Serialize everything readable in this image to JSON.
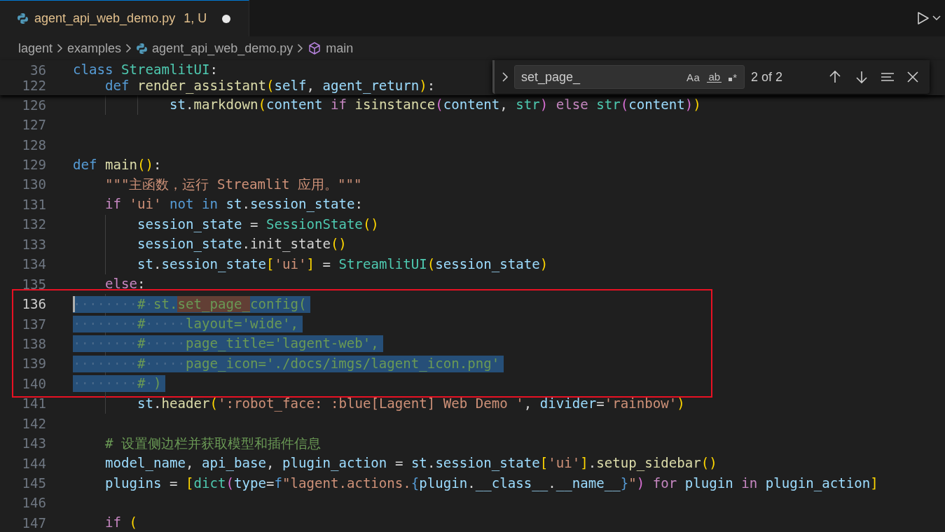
{
  "tabs": [
    {
      "title": "agent_api_web_demo.py",
      "status": "1, U",
      "dirty": true,
      "selected": true
    }
  ],
  "breadcrumbs": [
    {
      "text": "lagent",
      "kind": "folder"
    },
    {
      "text": "examples",
      "kind": "folder"
    },
    {
      "text": "agent_api_web_demo.py",
      "kind": "python-file"
    },
    {
      "text": "main",
      "kind": "symbol"
    }
  ],
  "find": {
    "query": "set_page_",
    "options": [
      {
        "label": "Aa",
        "kind": "case",
        "selected": false
      },
      {
        "label": "ab",
        "kind": "word",
        "selected": false
      },
      {
        "label": "*",
        "kind": "regex",
        "selected": false
      }
    ],
    "count": "2 of 2"
  },
  "annotation": {
    "kind": "rectangle",
    "color": "#e81123"
  },
  "sticky_lines": [
    {
      "number": "36",
      "tokens": [
        {
          "kind": "kw",
          "text": "class"
        },
        {
          "kind": "cls",
          "text": " StreamlitUI"
        },
        {
          "kind": "plain",
          "text": ":"
        }
      ]
    },
    {
      "number": "122",
      "tokens": [
        {
          "kind": "kw",
          "text": "    def"
        },
        {
          "kind": "fn",
          "text": " render_assistant"
        },
        {
          "kind": "b1",
          "text": "("
        },
        {
          "kind": "var",
          "text": "self"
        },
        {
          "kind": "plain",
          "text": ","
        },
        {
          "kind": "var",
          "text": " agent_return"
        },
        {
          "kind": "b1",
          "text": ")"
        },
        {
          "kind": "plain",
          "text": ":"
        }
      ]
    }
  ],
  "lines": [
    {
      "number": "126",
      "selected": false,
      "current": false,
      "tokens": [
        {
          "kind": "var",
          "text": "            st"
        },
        {
          "kind": "plain",
          "text": "."
        },
        {
          "kind": "fn",
          "text": "markdown"
        },
        {
          "kind": "b1",
          "text": "("
        },
        {
          "kind": "var",
          "text": "content"
        },
        {
          "kind": "ctl",
          "text": " if"
        },
        {
          "kind": "fn",
          "text": " isinstance"
        },
        {
          "kind": "b2",
          "text": "("
        },
        {
          "kind": "var",
          "text": "content"
        },
        {
          "kind": "plain",
          "text": ","
        },
        {
          "kind": "cls",
          "text": " str"
        },
        {
          "kind": "b2",
          "text": ")"
        },
        {
          "kind": "ctl",
          "text": " else"
        },
        {
          "kind": "cls",
          "text": " str"
        },
        {
          "kind": "b2",
          "text": "("
        },
        {
          "kind": "var",
          "text": "content"
        },
        {
          "kind": "b2",
          "text": ")"
        },
        {
          "kind": "b1",
          "text": ")"
        }
      ]
    },
    {
      "number": "127",
      "selected": false,
      "current": false
    },
    {
      "number": "128",
      "selected": false,
      "current": false
    },
    {
      "number": "129",
      "selected": false,
      "current": false,
      "tokens": [
        {
          "kind": "kw",
          "text": "def"
        },
        {
          "kind": "fn",
          "text": " main"
        },
        {
          "kind": "b1",
          "text": "()"
        },
        {
          "kind": "plain",
          "text": ":"
        }
      ]
    },
    {
      "number": "130",
      "selected": false,
      "current": false,
      "tokens": [
        {
          "kind": "str",
          "text": "    \"\"\"主函数，运行 Streamlit 应用。\"\"\""
        }
      ]
    },
    {
      "number": "131",
      "selected": false,
      "current": false,
      "tokens": [
        {
          "kind": "ctl",
          "text": "    if"
        },
        {
          "kind": "str",
          "text": " 'ui'"
        },
        {
          "kind": "kw",
          "text": " not in"
        },
        {
          "kind": "var",
          "text": " st"
        },
        {
          "kind": "plain",
          "text": "."
        },
        {
          "kind": "var",
          "text": "session_state"
        },
        {
          "kind": "plain",
          "text": ":"
        }
      ]
    },
    {
      "number": "132",
      "selected": false,
      "current": false,
      "tokens": [
        {
          "kind": "var",
          "text": "        session_state"
        },
        {
          "kind": "plain",
          "text": " ="
        },
        {
          "kind": "cls",
          "text": " SessionState"
        },
        {
          "kind": "b1",
          "text": "()"
        }
      ]
    },
    {
      "number": "133",
      "selected": false,
      "current": false,
      "tokens": [
        {
          "kind": "var",
          "text": "        session_state"
        },
        {
          "kind": "plain",
          "text": ".init_state"
        },
        {
          "kind": "b1",
          "text": "()"
        }
      ]
    },
    {
      "number": "134",
      "selected": false,
      "current": false,
      "tokens": [
        {
          "kind": "var",
          "text": "        st"
        },
        {
          "kind": "plain",
          "text": "."
        },
        {
          "kind": "var",
          "text": "session_state"
        },
        {
          "kind": "b1",
          "text": "["
        },
        {
          "kind": "str",
          "text": "'ui'"
        },
        {
          "kind": "b1",
          "text": "]"
        },
        {
          "kind": "plain",
          "text": " ="
        },
        {
          "kind": "cls",
          "text": " StreamlitUI"
        },
        {
          "kind": "b1",
          "text": "("
        },
        {
          "kind": "var",
          "text": "session_state"
        },
        {
          "kind": "b1",
          "text": ")"
        }
      ]
    },
    {
      "number": "135",
      "selected": false,
      "current": false,
      "tokens": [
        {
          "kind": "ctl",
          "text": "    else"
        },
        {
          "kind": "plain",
          "text": ":"
        }
      ]
    },
    {
      "number": "136",
      "selected": true,
      "current": true,
      "tokens": [
        {
          "kind": "cmt",
          "text": "        # st."
        },
        {
          "kind": "match",
          "text": "set_page_"
        },
        {
          "kind": "cmt",
          "text": "config("
        }
      ]
    },
    {
      "number": "137",
      "selected": true,
      "current": false,
      "tokens": [
        {
          "kind": "cmt",
          "text": "        #     layout='wide',"
        }
      ]
    },
    {
      "number": "138",
      "selected": true,
      "current": false,
      "tokens": [
        {
          "kind": "cmt",
          "text": "        #     page_title='lagent-web',"
        }
      ]
    },
    {
      "number": "139",
      "selected": true,
      "current": false,
      "tokens": [
        {
          "kind": "cmt",
          "text": "        #     page_icon='./docs/imgs/lagent_icon.png'"
        }
      ]
    },
    {
      "number": "140",
      "selected": true,
      "current": false,
      "tokens": [
        {
          "kind": "cmt",
          "text": "        # )"
        }
      ]
    },
    {
      "number": "141",
      "selected": false,
      "current": false,
      "tokens": [
        {
          "kind": "var",
          "text": "        st"
        },
        {
          "kind": "plain",
          "text": "."
        },
        {
          "kind": "fn",
          "text": "header"
        },
        {
          "kind": "b1",
          "text": "("
        },
        {
          "kind": "str",
          "text": "':robot_face: :blue[Lagent] Web Demo '"
        },
        {
          "kind": "plain",
          "text": ","
        },
        {
          "kind": "var",
          "text": " divider"
        },
        {
          "kind": "plain",
          "text": "="
        },
        {
          "kind": "str",
          "text": "'rainbow'"
        },
        {
          "kind": "b1",
          "text": ")"
        }
      ]
    },
    {
      "number": "142",
      "selected": false,
      "current": false
    },
    {
      "number": "143",
      "selected": false,
      "current": false,
      "tokens": [
        {
          "kind": "cmt",
          "text": "    # 设置侧边栏并获取模型和插件信息"
        }
      ]
    },
    {
      "number": "144",
      "selected": false,
      "current": false,
      "tokens": [
        {
          "kind": "var",
          "text": "    model_name"
        },
        {
          "kind": "plain",
          "text": ","
        },
        {
          "kind": "var",
          "text": " api_base"
        },
        {
          "kind": "plain",
          "text": ","
        },
        {
          "kind": "var",
          "text": " plugin_action"
        },
        {
          "kind": "plain",
          "text": " ="
        },
        {
          "kind": "var",
          "text": " st"
        },
        {
          "kind": "plain",
          "text": "."
        },
        {
          "kind": "var",
          "text": "session_state"
        },
        {
          "kind": "b1",
          "text": "["
        },
        {
          "kind": "str",
          "text": "'ui'"
        },
        {
          "kind": "b1",
          "text": "]"
        },
        {
          "kind": "plain",
          "text": "."
        },
        {
          "kind": "fn",
          "text": "setup_sidebar"
        },
        {
          "kind": "b1",
          "text": "()"
        }
      ]
    },
    {
      "number": "145",
      "selected": false,
      "current": false,
      "tokens": [
        {
          "kind": "var",
          "text": "    plugins"
        },
        {
          "kind": "plain",
          "text": " ="
        },
        {
          "kind": "b1",
          "text": " ["
        },
        {
          "kind": "cls",
          "text": "dict"
        },
        {
          "kind": "b2",
          "text": "("
        },
        {
          "kind": "var",
          "text": "type"
        },
        {
          "kind": "plain",
          "text": "="
        },
        {
          "kind": "kw",
          "text": "f"
        },
        {
          "kind": "str",
          "text": "\"lagent.actions."
        },
        {
          "kind": "kw",
          "text": "{"
        },
        {
          "kind": "var",
          "text": "plugin"
        },
        {
          "kind": "plain",
          "text": "."
        },
        {
          "kind": "var",
          "text": "__class__"
        },
        {
          "kind": "plain",
          "text": "."
        },
        {
          "kind": "var",
          "text": "__name__"
        },
        {
          "kind": "kw",
          "text": "}"
        },
        {
          "kind": "str",
          "text": "\""
        },
        {
          "kind": "b2",
          "text": ")"
        },
        {
          "kind": "ctl",
          "text": " for"
        },
        {
          "kind": "var",
          "text": " plugin"
        },
        {
          "kind": "ctl",
          "text": " in"
        },
        {
          "kind": "var",
          "text": " plugin_action"
        },
        {
          "kind": "b1",
          "text": "]"
        }
      ]
    },
    {
      "number": "146",
      "selected": false,
      "current": false
    },
    {
      "number": "147",
      "selected": false,
      "current": false,
      "tokens": [
        {
          "kind": "ctl",
          "text": "    if"
        },
        {
          "kind": "b1",
          "text": " ("
        }
      ]
    }
  ]
}
